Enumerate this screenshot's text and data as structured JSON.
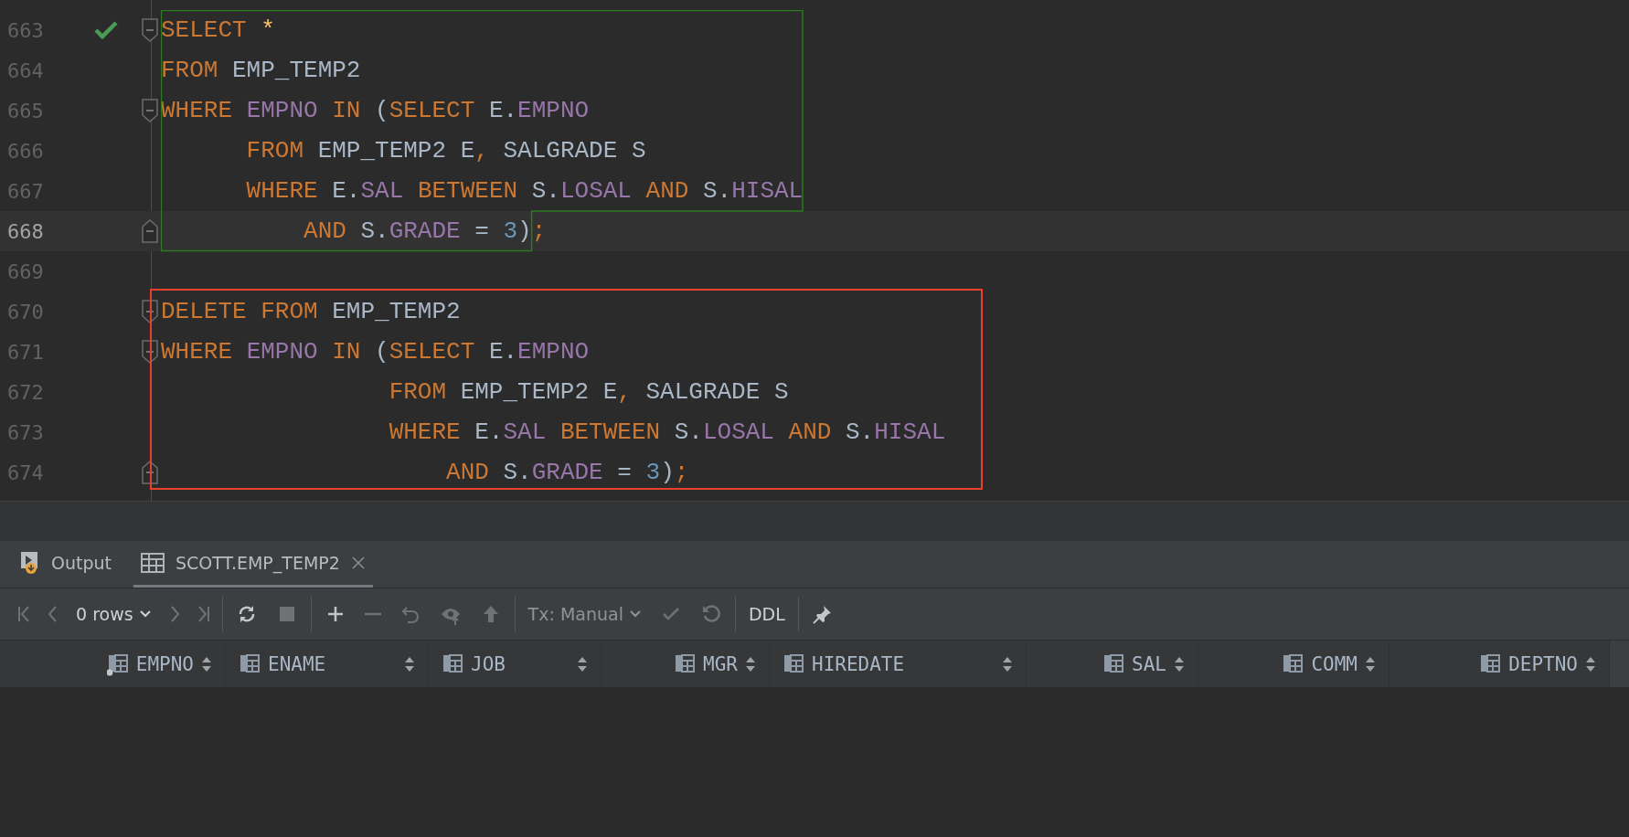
{
  "editor": {
    "lines": [
      {
        "number": "663",
        "executed": true,
        "fold_start": true,
        "fold_end": false,
        "current": false,
        "tokens": [
          {
            "kind": "keyword",
            "text": "SELECT "
          },
          {
            "kind": "star",
            "text": "*"
          }
        ]
      },
      {
        "number": "664",
        "executed": false,
        "fold_start": false,
        "fold_end": false,
        "current": false,
        "tokens": [
          {
            "kind": "keyword",
            "text": "FROM "
          },
          {
            "kind": "ident",
            "text": "EMP_TEMP2"
          }
        ]
      },
      {
        "number": "665",
        "executed": false,
        "fold_start": true,
        "fold_end": false,
        "current": false,
        "tokens": [
          {
            "kind": "keyword",
            "text": "WHERE "
          },
          {
            "kind": "column",
            "text": "EMPNO "
          },
          {
            "kind": "keyword",
            "text": "IN "
          },
          {
            "kind": "ident",
            "text": "("
          },
          {
            "kind": "keyword",
            "text": "SELECT "
          },
          {
            "kind": "ident",
            "text": "E."
          },
          {
            "kind": "column",
            "text": "EMPNO"
          }
        ]
      },
      {
        "number": "666",
        "executed": false,
        "fold_start": false,
        "fold_end": false,
        "current": false,
        "tokens": [
          {
            "kind": "keyword",
            "text": "      FROM "
          },
          {
            "kind": "ident",
            "text": "EMP_TEMP2 E"
          },
          {
            "kind": "punct",
            "text": ","
          },
          {
            "kind": "ident",
            "text": " SALGRADE S"
          }
        ]
      },
      {
        "number": "667",
        "executed": false,
        "fold_start": false,
        "fold_end": false,
        "current": false,
        "tokens": [
          {
            "kind": "keyword",
            "text": "      WHERE "
          },
          {
            "kind": "ident",
            "text": "E."
          },
          {
            "kind": "column",
            "text": "SAL "
          },
          {
            "kind": "keyword",
            "text": "BETWEEN "
          },
          {
            "kind": "ident",
            "text": "S."
          },
          {
            "kind": "column",
            "text": "LOSAL "
          },
          {
            "kind": "keyword",
            "text": "AND "
          },
          {
            "kind": "ident",
            "text": "S."
          },
          {
            "kind": "column",
            "text": "HISAL"
          }
        ]
      },
      {
        "number": "668",
        "executed": false,
        "fold_start": false,
        "fold_end": true,
        "current": true,
        "tokens": [
          {
            "kind": "keyword",
            "text": "          AND "
          },
          {
            "kind": "ident",
            "text": "S."
          },
          {
            "kind": "column",
            "text": "GRADE "
          },
          {
            "kind": "ident",
            "text": "= "
          },
          {
            "kind": "number",
            "text": "3"
          },
          {
            "kind": "ident",
            "text": ")"
          },
          {
            "kind": "punct",
            "text": ";"
          }
        ]
      },
      {
        "number": "669",
        "executed": false,
        "fold_start": false,
        "fold_end": false,
        "current": false
      },
      {
        "number": "670",
        "executed": false,
        "fold_start": true,
        "fold_end": false,
        "current": false,
        "tokens": [
          {
            "kind": "keyword",
            "text": "DELETE FROM "
          },
          {
            "kind": "ident",
            "text": "EMP_TEMP2"
          }
        ]
      },
      {
        "number": "671",
        "executed": false,
        "fold_start": true,
        "fold_end": false,
        "current": false,
        "tokens": [
          {
            "kind": "keyword",
            "text": "WHERE "
          },
          {
            "kind": "column",
            "text": "EMPNO "
          },
          {
            "kind": "keyword",
            "text": "IN "
          },
          {
            "kind": "ident",
            "text": "("
          },
          {
            "kind": "keyword",
            "text": "SELECT "
          },
          {
            "kind": "ident",
            "text": "E."
          },
          {
            "kind": "column",
            "text": "EMPNO"
          }
        ]
      },
      {
        "number": "672",
        "executed": false,
        "fold_start": false,
        "fold_end": false,
        "current": false,
        "tokens": [
          {
            "kind": "keyword",
            "text": "                FROM "
          },
          {
            "kind": "ident",
            "text": "EMP_TEMP2 E"
          },
          {
            "kind": "punct",
            "text": ","
          },
          {
            "kind": "ident",
            "text": " SALGRADE S"
          }
        ]
      },
      {
        "number": "673",
        "executed": false,
        "fold_start": false,
        "fold_end": false,
        "current": false,
        "tokens": [
          {
            "kind": "keyword",
            "text": "                WHERE "
          },
          {
            "kind": "ident",
            "text": "E."
          },
          {
            "kind": "column",
            "text": "SAL "
          },
          {
            "kind": "keyword",
            "text": "BETWEEN "
          },
          {
            "kind": "ident",
            "text": "S."
          },
          {
            "kind": "column",
            "text": "LOSAL "
          },
          {
            "kind": "keyword",
            "text": "AND "
          },
          {
            "kind": "ident",
            "text": "S."
          },
          {
            "kind": "column",
            "text": "HISAL"
          }
        ]
      },
      {
        "number": "674",
        "executed": false,
        "fold_start": false,
        "fold_end": true,
        "current": false,
        "tokens": [
          {
            "kind": "keyword",
            "text": "                    AND "
          },
          {
            "kind": "ident",
            "text": "S."
          },
          {
            "kind": "column",
            "text": "GRADE "
          },
          {
            "kind": "ident",
            "text": "= "
          },
          {
            "kind": "number",
            "text": "3"
          },
          {
            "kind": "ident",
            "text": ")"
          },
          {
            "kind": "punct",
            "text": ";"
          }
        ]
      }
    ]
  },
  "tool_window": {
    "tabs": [
      {
        "label": "Output",
        "kind": "output",
        "selected": false,
        "closable": false
      },
      {
        "label": "SCOTT.EMP_TEMP2",
        "kind": "table",
        "selected": true,
        "closable": true
      }
    ],
    "toolbar": {
      "groups": [
        [
          {
            "kind": "first",
            "disabled": true
          },
          {
            "kind": "prev",
            "disabled": true
          },
          {
            "kind": "dropdown",
            "label": "0 rows",
            "disabled": false
          },
          {
            "kind": "next",
            "disabled": true
          },
          {
            "kind": "last",
            "disabled": true
          }
        ],
        [
          {
            "kind": "refresh",
            "disabled": false
          },
          {
            "kind": "stop",
            "disabled": true
          }
        ],
        [
          {
            "kind": "add",
            "disabled": false
          },
          {
            "kind": "remove",
            "disabled": true
          },
          {
            "kind": "revert",
            "disabled": true
          },
          {
            "kind": "view",
            "disabled": true
          },
          {
            "kind": "submit",
            "disabled": true
          }
        ],
        [
          {
            "kind": "dropdown",
            "label": "Tx: Manual",
            "disabled": true
          },
          {
            "kind": "commit",
            "disabled": true
          },
          {
            "kind": "rollback",
            "disabled": true
          }
        ],
        [
          {
            "kind": "text",
            "label": "DDL",
            "disabled": false
          }
        ],
        [
          {
            "kind": "pin",
            "disabled": false
          }
        ]
      ]
    },
    "columns": [
      {
        "name": "EMPNO",
        "kind": "number",
        "primary_key": true
      },
      {
        "name": "ENAME",
        "kind": "text",
        "primary_key": false
      },
      {
        "name": "JOB",
        "kind": "text",
        "primary_key": false
      },
      {
        "name": "MGR",
        "kind": "number",
        "primary_key": false
      },
      {
        "name": "HIREDATE",
        "kind": "text",
        "primary_key": false
      },
      {
        "name": "SAL",
        "kind": "number",
        "primary_key": false
      },
      {
        "name": "COMM",
        "kind": "number",
        "primary_key": false
      },
      {
        "name": "DEPTNO",
        "kind": "number",
        "primary_key": false
      }
    ]
  }
}
